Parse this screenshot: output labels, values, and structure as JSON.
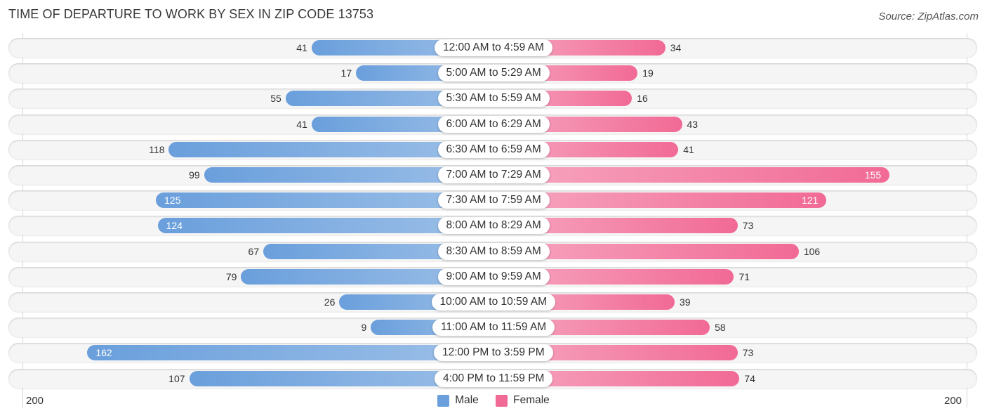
{
  "title": "TIME OF DEPARTURE TO WORK BY SEX IN ZIP CODE 13753",
  "source": "Source: ZipAtlas.com",
  "colors": {
    "male": "#6a9fdc",
    "female": "#f16a95"
  },
  "chart_data": {
    "type": "bar",
    "orientation": "horizontal-diverging",
    "title": "TIME OF DEPARTURE TO WORK BY SEX IN ZIP CODE 13753",
    "categories": [
      "12:00 AM to 4:59 AM",
      "5:00 AM to 5:29 AM",
      "5:30 AM to 5:59 AM",
      "6:00 AM to 6:29 AM",
      "6:30 AM to 6:59 AM",
      "7:00 AM to 7:29 AM",
      "7:30 AM to 7:59 AM",
      "8:00 AM to 8:29 AM",
      "8:30 AM to 8:59 AM",
      "9:00 AM to 9:59 AM",
      "10:00 AM to 10:59 AM",
      "11:00 AM to 11:59 AM",
      "12:00 PM to 3:59 PM",
      "4:00 PM to 11:59 PM"
    ],
    "series": [
      {
        "name": "Male",
        "values": [
          41,
          17,
          55,
          41,
          118,
          99,
          125,
          124,
          67,
          79,
          26,
          9,
          162,
          107
        ]
      },
      {
        "name": "Female",
        "values": [
          34,
          19,
          16,
          43,
          41,
          155,
          121,
          73,
          106,
          71,
          39,
          58,
          73,
          74
        ]
      }
    ],
    "xlim": [
      0,
      200
    ],
    "axis_ticks": {
      "left": "200",
      "right": "200"
    },
    "legend": {
      "placement": "bottom-center",
      "entries": [
        "Male",
        "Female"
      ]
    },
    "grid": false
  }
}
